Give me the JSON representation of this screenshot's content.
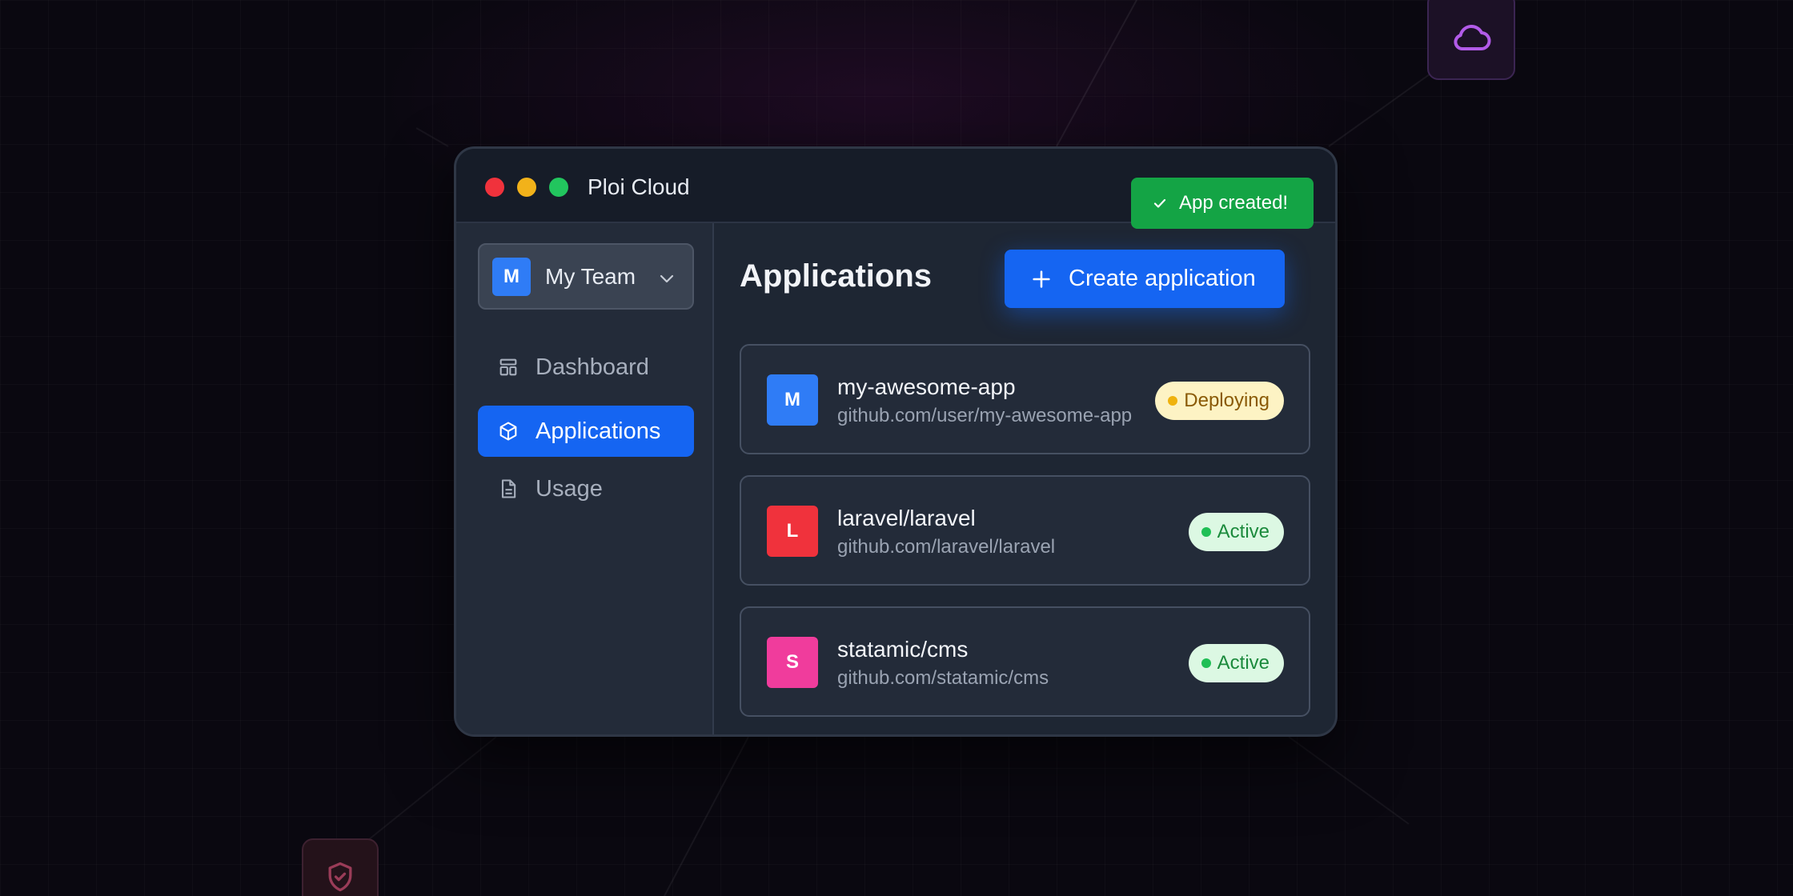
{
  "window": {
    "title": "Ploi Cloud"
  },
  "toast": {
    "message": "App created!",
    "icon": "check-icon"
  },
  "team": {
    "initial": "M",
    "name": "My Team"
  },
  "sidebar": {
    "items": [
      {
        "label": "Dashboard",
        "icon": "dashboard-icon",
        "active": false
      },
      {
        "label": "Applications",
        "icon": "cube-icon",
        "active": true
      },
      {
        "label": "Usage",
        "icon": "document-icon",
        "active": false
      }
    ]
  },
  "main": {
    "title": "Applications",
    "create_label": "Create application",
    "apps": [
      {
        "initial": "M",
        "name": "my-awesome-app",
        "url": "github.com/user/my-awesome-app",
        "status": "Deploying",
        "color": "#2f7cf6"
      },
      {
        "initial": "L",
        "name": "laravel/laravel",
        "url": "github.com/laravel/laravel",
        "status": "Active",
        "color": "#f0323c"
      },
      {
        "initial": "S",
        "name": "statamic/cms",
        "url": "github.com/statamic/cms",
        "status": "Active",
        "color": "#f03c9c"
      }
    ]
  },
  "colors": {
    "accent": "#1565f2",
    "success": "#14a445",
    "deploying": "#efb20e",
    "active": "#1fbf55"
  }
}
